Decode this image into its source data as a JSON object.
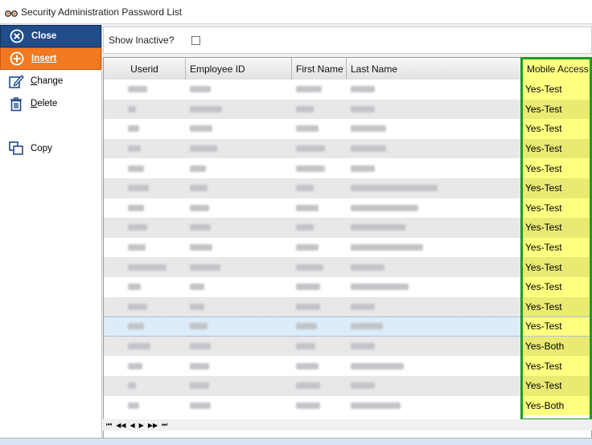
{
  "window": {
    "title": "Security Administration Password List"
  },
  "sidebar": {
    "close_label": "Close",
    "insert_label": "Insert",
    "change_label": "Change",
    "delete_label": "Delete",
    "copy_label": "Copy"
  },
  "filter": {
    "show_inactive_label": "Show Inactive?",
    "show_inactive_checked": false
  },
  "columns": [
    "Userid",
    "Employee ID",
    "First Name",
    "Last Name",
    "Mobile Access"
  ],
  "rows": [
    {
      "mobile": "Yes-Test"
    },
    {
      "mobile": "Yes-Test"
    },
    {
      "mobile": "Yes-Test"
    },
    {
      "mobile": "Yes-Test"
    },
    {
      "mobile": "Yes-Test"
    },
    {
      "mobile": "Yes-Test"
    },
    {
      "mobile": "Yes-Test"
    },
    {
      "mobile": "Yes-Test"
    },
    {
      "mobile": "Yes-Test"
    },
    {
      "mobile": "Yes-Test"
    },
    {
      "mobile": "Yes-Test"
    },
    {
      "mobile": "Yes-Test"
    },
    {
      "mobile": "Yes-Test"
    },
    {
      "mobile": "Yes-Both"
    },
    {
      "mobile": "Yes-Test"
    },
    {
      "mobile": "Yes-Test"
    },
    {
      "mobile": "Yes-Both"
    }
  ],
  "selected_row": 12,
  "pager": {
    "first": "⏮",
    "prev_page": "◀◀",
    "prev": "◀",
    "next": "▶",
    "next_page": "▶▶",
    "last": "⏭"
  },
  "colors": {
    "close_bg": "#214c8a",
    "insert_bg": "#f07921",
    "mobile_highlight": "#ffff80",
    "mobile_frame": "#1f9a2a"
  }
}
